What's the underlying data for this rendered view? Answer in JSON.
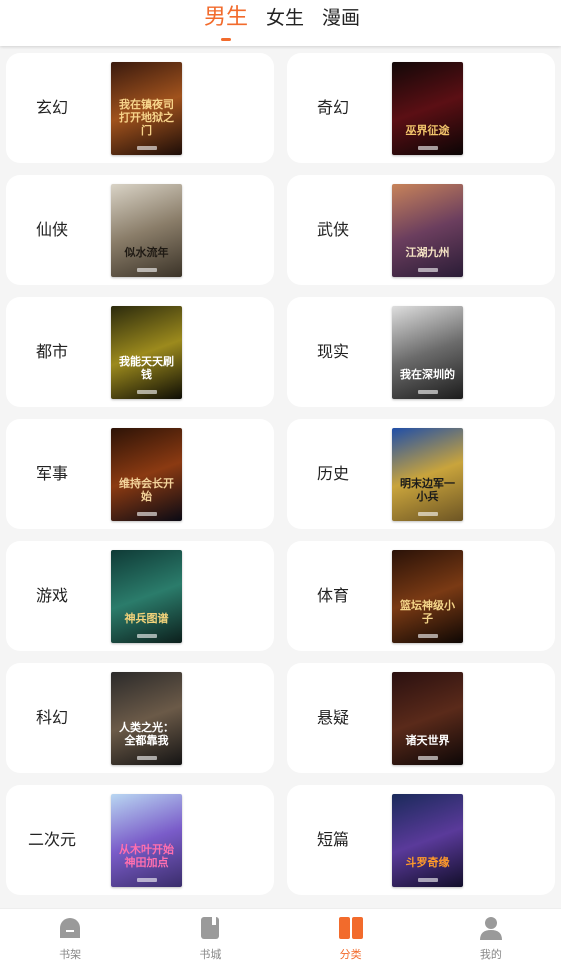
{
  "top_tabs": [
    "男生",
    "女生",
    "漫画"
  ],
  "active_tab": "男生",
  "categories": [
    {
      "label": "玄幻",
      "cover_title": "我在镇夜司打开地狱之门",
      "colors": [
        "#3a1a0e",
        "#a0521d",
        "#1d0d08"
      ],
      "text_color": "#f6d38a"
    },
    {
      "label": "奇幻",
      "cover_title": "巫界征途",
      "colors": [
        "#120808",
        "#5b0f14",
        "#0b0505"
      ],
      "text_color": "#f1c46b"
    },
    {
      "label": "仙侠",
      "cover_title": "似水流年",
      "colors": [
        "#d9d3c6",
        "#8a7d69",
        "#3b3328"
      ],
      "text_color": "#1f1a14"
    },
    {
      "label": "武侠",
      "cover_title": "江湖九州",
      "colors": [
        "#c7835a",
        "#6b3e5e",
        "#2a1c36"
      ],
      "text_color": "#f3e2c3"
    },
    {
      "label": "都市",
      "cover_title": "我能天天刷钱",
      "colors": [
        "#2b2a0d",
        "#9c8a1d",
        "#0e0d05"
      ],
      "text_color": "#ffffff"
    },
    {
      "label": "现实",
      "cover_title": "我在深圳的",
      "colors": [
        "#dedede",
        "#6b6b6b",
        "#1c1c1c"
      ],
      "text_color": "#ffffff"
    },
    {
      "label": "军事",
      "cover_title": "维持会长开始",
      "colors": [
        "#2d1307",
        "#8b3a12",
        "#0a0a14"
      ],
      "text_color": "#f3d39b"
    },
    {
      "label": "历史",
      "cover_title": "明末边军一小兵",
      "colors": [
        "#1f4ea8",
        "#c9a43c",
        "#6d5524"
      ],
      "text_color": "#1a1a1a"
    },
    {
      "label": "游戏",
      "cover_title": "神兵图谱",
      "colors": [
        "#0f3a36",
        "#2b7c6b",
        "#0c1f1c"
      ],
      "text_color": "#f1d27a"
    },
    {
      "label": "体育",
      "cover_title": "篮坛神级小子",
      "colors": [
        "#2a1208",
        "#7a3a14",
        "#0e0704"
      ],
      "text_color": "#f5d68a"
    },
    {
      "label": "科幻",
      "cover_title": "人类之光：全都靠我",
      "colors": [
        "#2b2a2a",
        "#6b5a48",
        "#151414"
      ],
      "text_color": "#ffffff"
    },
    {
      "label": "悬疑",
      "cover_title": "诸天世界",
      "colors": [
        "#2a1010",
        "#5a2a1a",
        "#0d0707"
      ],
      "text_color": "#ffffff"
    },
    {
      "label": "二次元",
      "cover_title": "从木叶开始神田加点",
      "colors": [
        "#b9d7f2",
        "#7a5cc9",
        "#3a2d6b"
      ],
      "text_color": "#ff6fae"
    },
    {
      "label": "短篇",
      "cover_title": "斗罗奇缘",
      "colors": [
        "#1a2a5a",
        "#5a3a9a",
        "#120e2a"
      ],
      "text_color": "#ff9a2a"
    }
  ],
  "bottom_nav": [
    {
      "label": "书架",
      "icon": "bookshelf-icon",
      "active": false
    },
    {
      "label": "书城",
      "icon": "bookstore-icon",
      "active": false
    },
    {
      "label": "分类",
      "icon": "category-icon",
      "active": true
    },
    {
      "label": "我的",
      "icon": "profile-icon",
      "active": false
    }
  ],
  "colors": {
    "accent": "#f26b2c",
    "inactive": "#888888",
    "background": "#f5f5f5"
  }
}
